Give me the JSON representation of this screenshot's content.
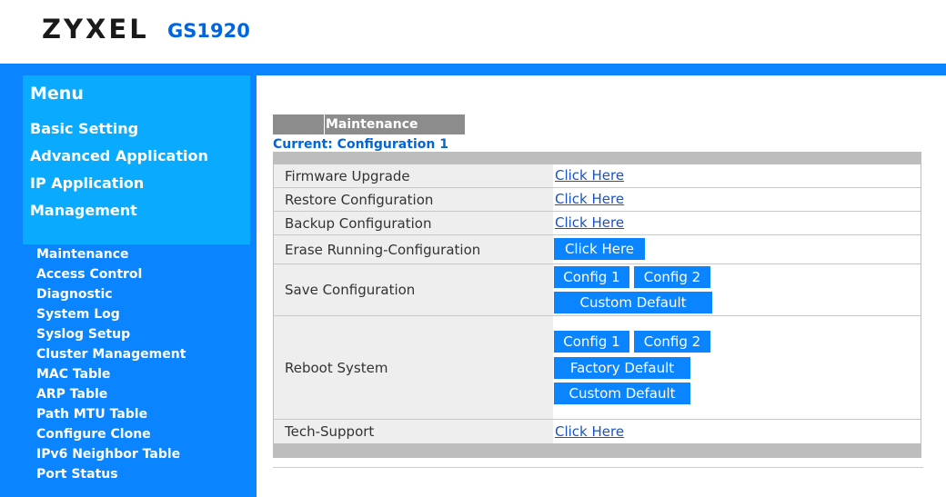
{
  "header": {
    "brand": "ZYXEL",
    "model": "GS1920"
  },
  "sidebar": {
    "title": "Menu",
    "categories": [
      "Basic Setting",
      "Advanced Application",
      "IP Application",
      "Management"
    ],
    "sub_items": [
      "Maintenance",
      "Access Control",
      "Diagnostic",
      "System Log",
      "Syslog Setup",
      "Cluster Management",
      "MAC Table",
      "ARP Table",
      "Path MTU Table",
      "Configure Clone",
      "IPv6 Neighbor Table",
      "Port Status"
    ]
  },
  "main": {
    "tab_label": "Maintenance",
    "current_config": "Current: Configuration 1",
    "rows": {
      "firmware": {
        "label": "Firmware Upgrade",
        "link": "Click Here"
      },
      "restore": {
        "label": "Restore Configuration",
        "link": "Click Here"
      },
      "backup": {
        "label": "Backup Configuration",
        "link": "Click Here"
      },
      "erase": {
        "label": "Erase Running-Configuration",
        "button": "Click Here"
      },
      "save": {
        "label": "Save Configuration",
        "config1": "Config 1",
        "config2": "Config 2",
        "custom_default": "Custom Default"
      },
      "reboot": {
        "label": "Reboot System",
        "config1": "Config 1",
        "config2": "Config 2",
        "factory_default": "Factory Default",
        "custom_default": "Custom Default"
      },
      "tech": {
        "label": "Tech-Support",
        "link": "Click Here"
      }
    }
  },
  "colors": {
    "accent_blue": "#0a84ff",
    "menu_light_blue": "#0aabff",
    "brand_blue": "#0066e0",
    "link_blue": "#1a53c9"
  }
}
